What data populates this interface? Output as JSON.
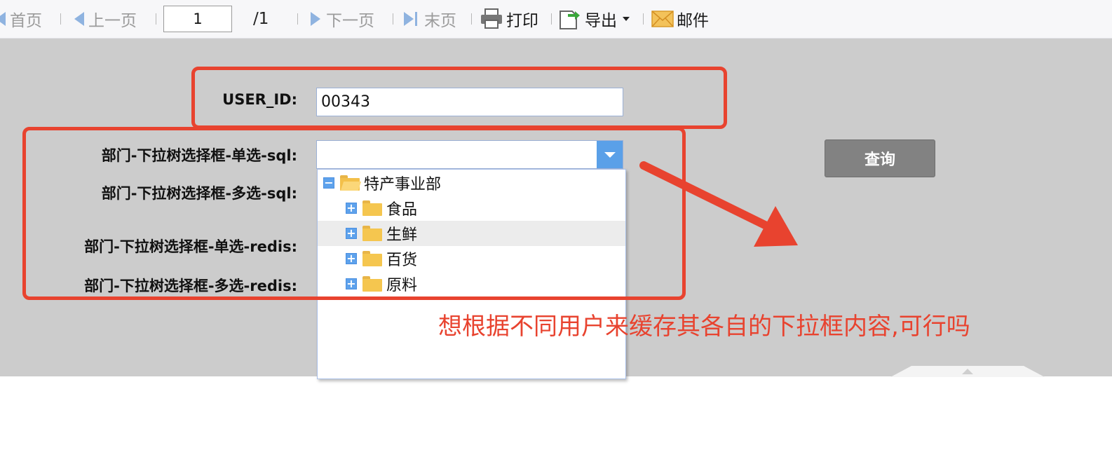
{
  "toolbar": {
    "first": "首页",
    "prev": "上一页",
    "page_value": "1",
    "page_total": "/1",
    "next": "下一页",
    "last": "末页",
    "print": "打印",
    "export": "导出",
    "mail": "邮件"
  },
  "form": {
    "user_id_label": "USER_ID:",
    "user_id_value": "00343",
    "dept_single_sql": "部门-下拉树选择框-单选-sql:",
    "dept_multi_sql": "部门-下拉树选择框-多选-sql:",
    "dept_single_redis": "部门-下拉树选择框-单选-redis:",
    "dept_multi_redis": "部门-下拉树选择框-多选-redis:",
    "query_button": "查询"
  },
  "tree": {
    "root": "特产事业部",
    "children": [
      "食品",
      "生鲜",
      "百货",
      "原料"
    ]
  },
  "annotation": {
    "note": "想根据不同用户来缓存其各自的下拉框内容,可行吗"
  },
  "colors": {
    "annotation": "#e8432f",
    "toolbar_icon": "#8fb3e0",
    "combo_button": "#5aa0e8"
  }
}
